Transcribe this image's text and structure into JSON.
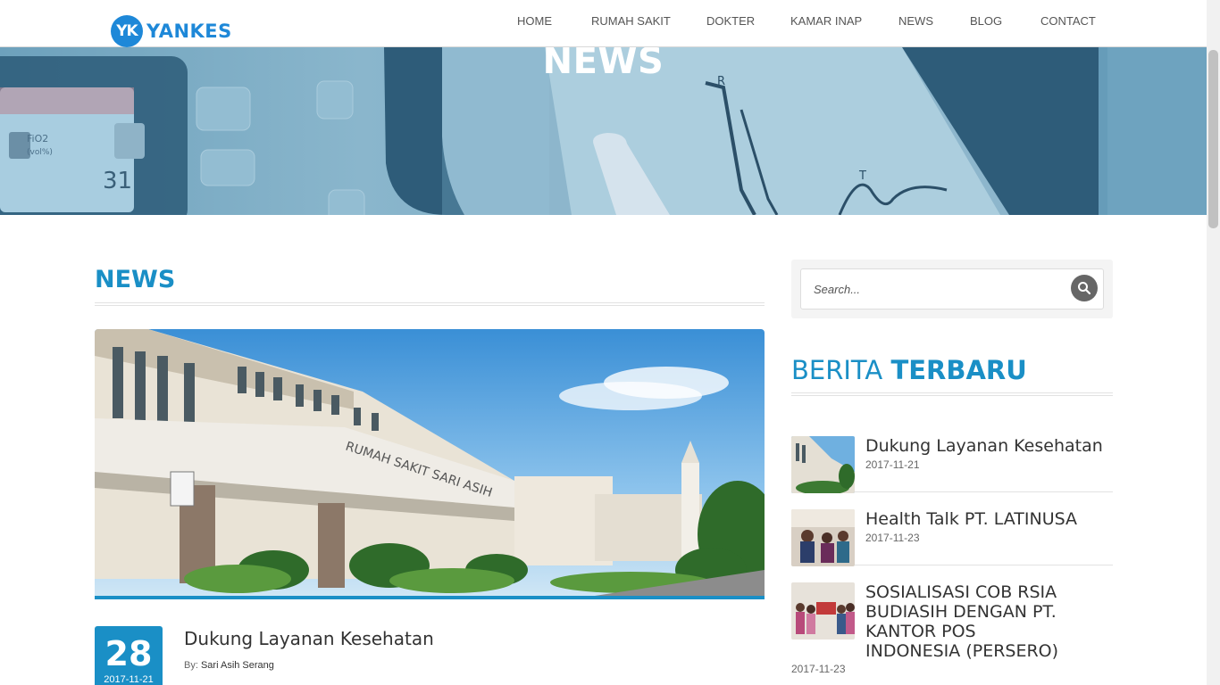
{
  "brand": {
    "badge": "YK",
    "name": "YANKES",
    "color": "#1e88d8"
  },
  "nav": [
    {
      "label": "HOME"
    },
    {
      "label": "RUMAH SAKIT"
    },
    {
      "label": "DOKTER"
    },
    {
      "label": "KAMAR INAP"
    },
    {
      "label": "NEWS"
    },
    {
      "label": "BLOG"
    },
    {
      "label": "CONTACT"
    }
  ],
  "hero": {
    "title": "NEWS"
  },
  "main": {
    "heading": "NEWS",
    "post": {
      "day": "28",
      "date": "2017-11-21",
      "title": "Dukung Layanan Kesehatan",
      "by_label": "By:",
      "author": "Sari Asih Serang"
    }
  },
  "sidebar": {
    "search": {
      "placeholder": "Search..."
    },
    "heading_light": "BERITA",
    "heading_bold": "TERBARU",
    "items": [
      {
        "title": "Dukung Layanan Kesehatan",
        "date": "2017-11-21"
      },
      {
        "title": "Health Talk PT. LATINUSA",
        "date": "2017-11-23"
      },
      {
        "title": "SOSIALISASI COB RSIA BUDIASIH DENGAN PT. KANTOR POS INDONESIA (PERSERO)",
        "date": "2017-11-23"
      }
    ]
  },
  "colors": {
    "accent": "#1a8fc6",
    "text": "#333333"
  }
}
